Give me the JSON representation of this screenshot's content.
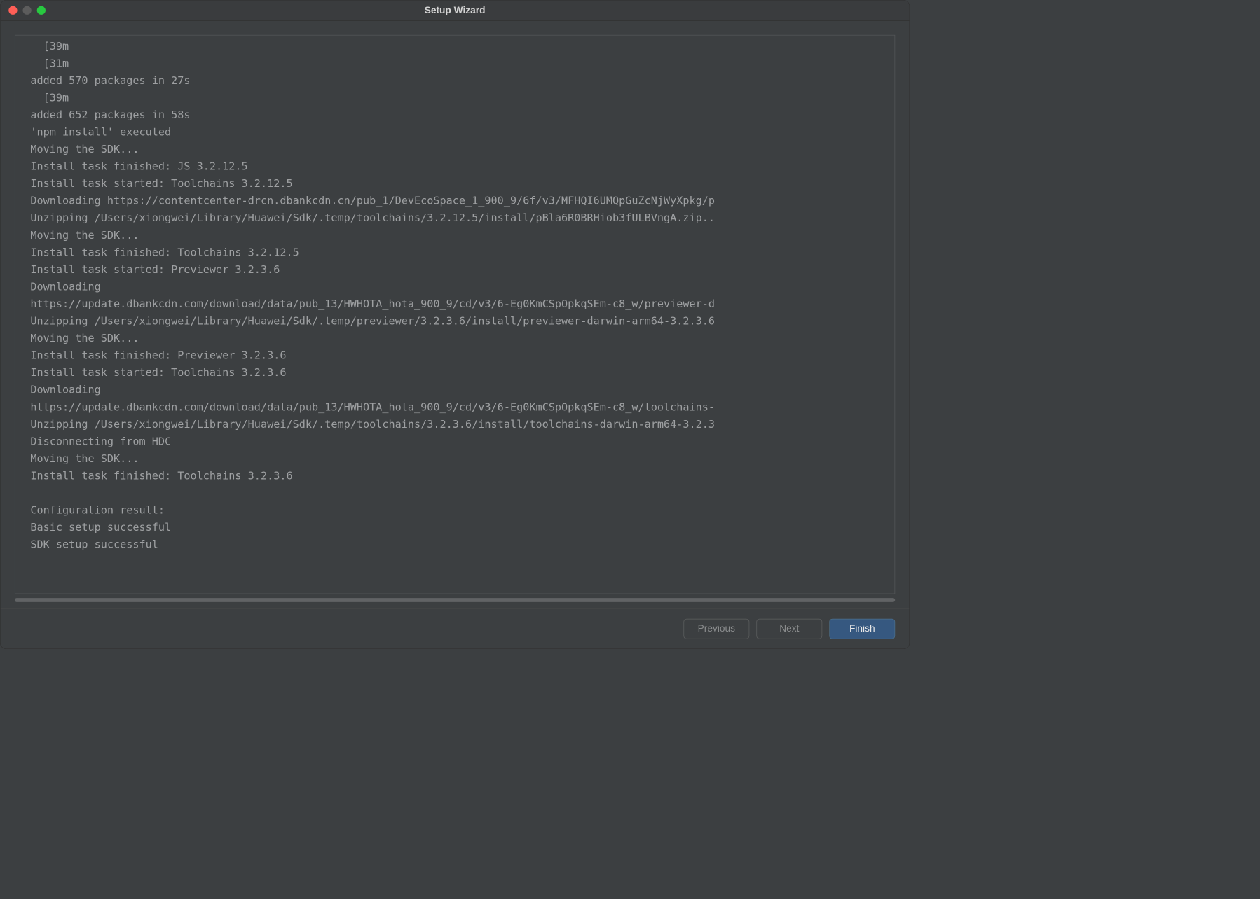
{
  "window": {
    "title": "Setup Wizard"
  },
  "log": {
    "lines": [
      "  [39m",
      "  [31m",
      "added 570 packages in 27s",
      "  [39m",
      "added 652 packages in 58s",
      "'npm install' executed",
      "Moving the SDK...",
      "Install task finished: JS 3.2.12.5",
      "Install task started: Toolchains 3.2.12.5",
      "Downloading https://contentcenter-drcn.dbankcdn.cn/pub_1/DevEcoSpace_1_900_9/6f/v3/MFHQI6UMQpGuZcNjWyXpkg/p",
      "Unzipping /Users/xiongwei/Library/Huawei/Sdk/.temp/toolchains/3.2.12.5/install/pBla6R0BRHiob3fULBVngA.zip..",
      "Moving the SDK...",
      "Install task finished: Toolchains 3.2.12.5",
      "Install task started: Previewer 3.2.3.6",
      "Downloading",
      "https://update.dbankcdn.com/download/data/pub_13/HWHOTA_hota_900_9/cd/v3/6-Eg0KmCSpOpkqSEm-c8_w/previewer-d",
      "Unzipping /Users/xiongwei/Library/Huawei/Sdk/.temp/previewer/3.2.3.6/install/previewer-darwin-arm64-3.2.3.6",
      "Moving the SDK...",
      "Install task finished: Previewer 3.2.3.6",
      "Install task started: Toolchains 3.2.3.6",
      "Downloading",
      "https://update.dbankcdn.com/download/data/pub_13/HWHOTA_hota_900_9/cd/v3/6-Eg0KmCSpOpkqSEm-c8_w/toolchains-",
      "Unzipping /Users/xiongwei/Library/Huawei/Sdk/.temp/toolchains/3.2.3.6/install/toolchains-darwin-arm64-3.2.3",
      "Disconnecting from HDC",
      "Moving the SDK...",
      "Install task finished: Toolchains 3.2.3.6",
      "",
      "Configuration result:",
      "Basic setup successful",
      "SDK setup successful"
    ]
  },
  "footer": {
    "previous_label": "Previous",
    "next_label": "Next",
    "finish_label": "Finish"
  }
}
